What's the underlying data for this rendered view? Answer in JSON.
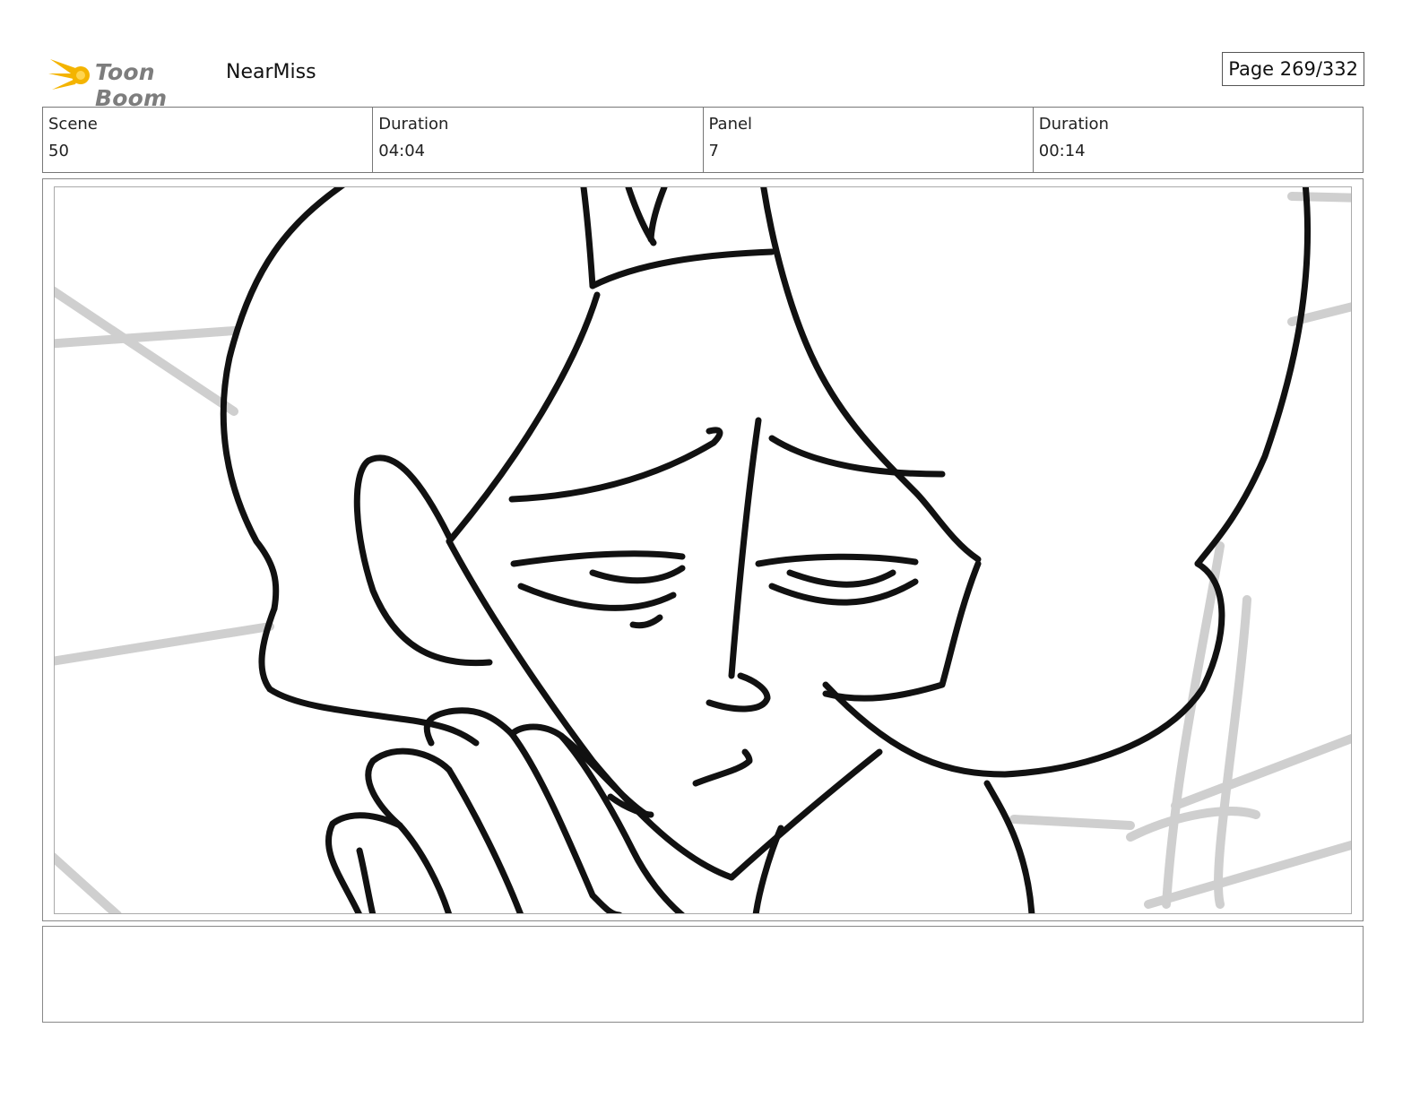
{
  "header": {
    "logo_text": "Toon Boom",
    "project_name": "NearMiss",
    "page_label": "Page 269/332"
  },
  "info": [
    {
      "label": "Scene",
      "value": "50"
    },
    {
      "label": "Duration",
      "value": "04:04"
    },
    {
      "label": "Panel",
      "value": "7"
    },
    {
      "label": "Duration",
      "value": "00:14"
    }
  ],
  "panel": {
    "description": "",
    "icons": [
      "toon-boom-logo-icon"
    ]
  },
  "notes": {
    "text": ""
  },
  "colors": {
    "logo_star": "#f4b400",
    "logo_text": "#7d7d7d",
    "line_art": "#111111",
    "background_sketch": "#cfcfcf"
  }
}
